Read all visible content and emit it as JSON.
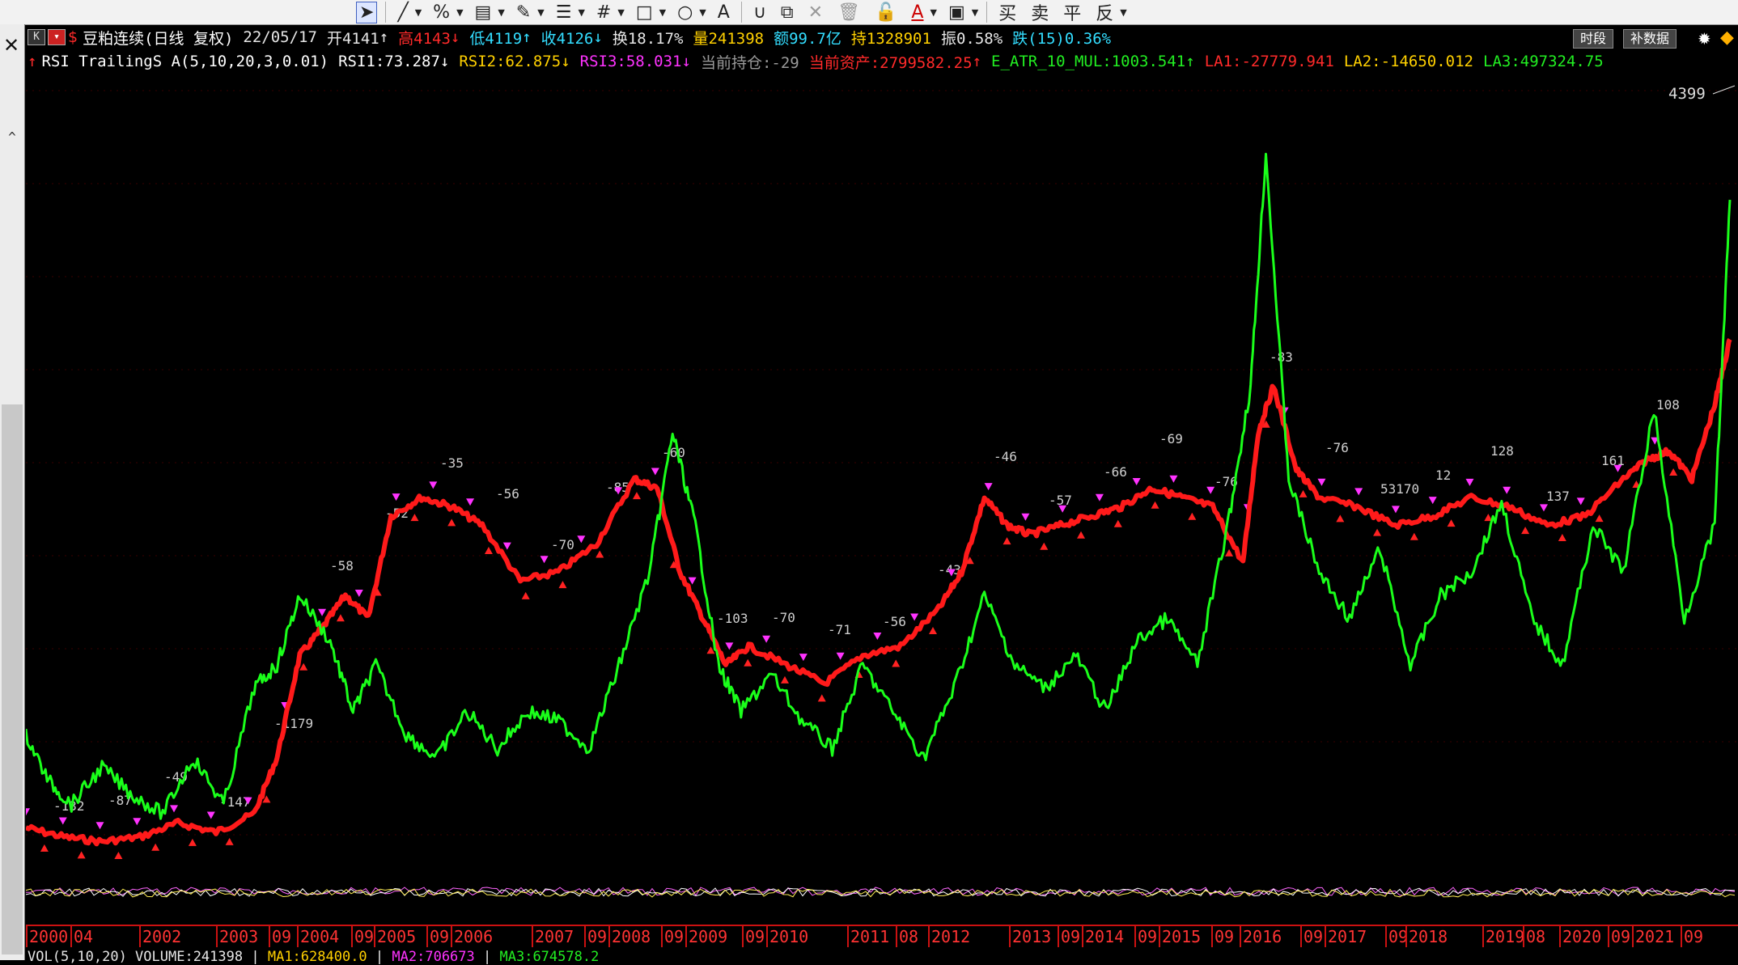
{
  "toolbar": {
    "icons": [
      "cursor-icon",
      "line-icon",
      "percent-icon",
      "ruler-icon",
      "pen-icon",
      "text-align-icon",
      "grid-icon",
      "rect-icon",
      "circle-icon",
      "text-icon",
      "magnet-icon",
      "copy-icon",
      "close-icon",
      "trash-icon",
      "lock-icon",
      "font-color-icon",
      "save-icon"
    ],
    "orders": [
      "买",
      "卖",
      "平",
      "反"
    ]
  },
  "header": {
    "k_label": "K",
    "title": "豆粕连续(日线 复权)",
    "date": "22/05/17",
    "open": "开4141",
    "high": "高4143",
    "low": "低4119",
    "close": "收4126",
    "turnover": "换18.17%",
    "volume": "量241398",
    "amount": "额99.7亿",
    "hold": "持1328901",
    "amplitude": "振0.58%",
    "fall": "跌(15)0.36%",
    "btn_period": "时段",
    "btn_supplement": "补数据"
  },
  "indicator": {
    "name": "RSI TrailingS A(5,10,20,3,0.01)",
    "rsi1": "RSI1:73.287",
    "rsi2": "RSI2:62.875",
    "rsi3": "RSI3:58.031",
    "position": "当前持仓:-29",
    "assets": "当前资产:2799582.25",
    "atr": "E_ATR_10_MUL:1003.541",
    "la1": "LA1:-27779.941",
    "la2": "LA2:-14650.012",
    "la3": "LA3:497324.75"
  },
  "price_label": "4399",
  "signal_labels": [
    "-132",
    "-87",
    "-49",
    "-147",
    "-1179",
    "-58",
    "-52",
    "-35",
    "-56",
    "-70",
    "-85",
    "-60",
    "-103",
    "-70",
    "-71",
    "-56",
    "-43",
    "-46",
    "-57",
    "-66",
    "-69",
    "-76",
    "-83",
    "-76",
    "53170",
    "12",
    "128",
    "137",
    "161",
    "108"
  ],
  "xaxis": [
    "2000",
    "04",
    "2002",
    "2003",
    "09",
    "2004",
    "09",
    "2005",
    "09",
    "2006",
    "2007",
    "09",
    "2008",
    "09",
    "2009",
    "09",
    "2010",
    "2011",
    "08",
    "2012",
    "2013",
    "09",
    "2014",
    "09",
    "2015",
    "09",
    "2016",
    "09",
    "2017",
    "09",
    "2018",
    "2019",
    "08",
    "2020",
    "09",
    "2021",
    "09"
  ],
  "footer": {
    "vol_name": "VOL(5,10,20) VOLUME:241398",
    "ma1": "MA1:628400.0",
    "ma2": "MA2:706673",
    "ma3": "MA3:674578.2"
  },
  "colors": {
    "equity": "#ff1a1a",
    "rsi": "#1aff1a",
    "labels": "#cfcfcf",
    "axis": "#ff3333"
  },
  "chart_data": {
    "type": "line",
    "series": [
      {
        "name": "",
        "color": "#ff1a1a",
        "x": [
          2000.0,
          2000.5,
          2001.0,
          2001.5,
          2002.0,
          2002.5,
          2003.0,
          2003.3,
          2003.6,
          2003.9,
          2004.2,
          2004.5,
          2004.8,
          2005.2,
          2005.6,
          2006.0,
          2006.5,
          2007.0,
          2007.5,
          2008.0,
          2008.3,
          2008.6,
          2008.9,
          2009.2,
          2009.5,
          2010.0,
          2010.5,
          2011.0,
          2011.5,
          2012.0,
          2012.3,
          2012.6,
          2012.9,
          2013.2,
          2013.6,
          2014.0,
          2014.4,
          2014.8,
          2015.2,
          2015.6,
          2016.0,
          2016.2,
          2016.4,
          2016.7,
          2017.0,
          2017.5,
          2018.0,
          2018.5,
          2019.0,
          2019.5,
          2020.0,
          2020.5,
          2021.0,
          2021.3,
          2021.6,
          2021.9,
          2022.2,
          2022.4
        ],
        "values": [
          5,
          3,
          2,
          3,
          6,
          4,
          8,
          20,
          42,
          48,
          55,
          50,
          72,
          76,
          74,
          70,
          58,
          60,
          66,
          80,
          78,
          60,
          50,
          40,
          44,
          40,
          36,
          42,
          44,
          52,
          60,
          76,
          70,
          68,
          70,
          72,
          74,
          78,
          76,
          74,
          62,
          90,
          100,
          82,
          76,
          74,
          70,
          72,
          76,
          74,
          70,
          72,
          80,
          84,
          86,
          80,
          96,
          110
        ]
      },
      {
        "name": "",
        "color": "#1aff1a",
        "x": [
          2000.0,
          2000.3,
          2000.6,
          2001.0,
          2001.4,
          2001.8,
          2002.2,
          2002.6,
          2003.0,
          2003.3,
          2003.6,
          2004.0,
          2004.3,
          2004.6,
          2005.0,
          2005.4,
          2005.8,
          2006.2,
          2006.6,
          2007.0,
          2007.4,
          2007.8,
          2008.2,
          2008.5,
          2008.8,
          2009.1,
          2009.4,
          2009.8,
          2010.2,
          2010.6,
          2011.0,
          2011.4,
          2011.8,
          2012.2,
          2012.6,
          2013.0,
          2013.4,
          2013.8,
          2014.2,
          2014.6,
          2015.0,
          2015.4,
          2015.8,
          2016.1,
          2016.3,
          2016.6,
          2017.0,
          2017.4,
          2017.8,
          2018.2,
          2018.6,
          2019.0,
          2019.4,
          2019.8,
          2020.2,
          2020.6,
          2021.0,
          2021.4,
          2021.8,
          2022.2,
          2022.4
        ],
        "values": [
          25,
          15,
          10,
          18,
          12,
          8,
          20,
          10,
          35,
          40,
          55,
          45,
          30,
          40,
          25,
          20,
          30,
          22,
          30,
          28,
          22,
          40,
          60,
          90,
          70,
          40,
          30,
          38,
          28,
          22,
          40,
          30,
          20,
          35,
          55,
          40,
          35,
          42,
          30,
          45,
          50,
          40,
          70,
          100,
          150,
          80,
          60,
          50,
          65,
          40,
          55,
          60,
          75,
          50,
          40,
          70,
          60,
          95,
          50,
          70,
          140
        ]
      }
    ],
    "xlim": [
      2000,
      2022.4
    ],
    "ylim": [
      0,
      160
    ],
    "grid": true
  }
}
